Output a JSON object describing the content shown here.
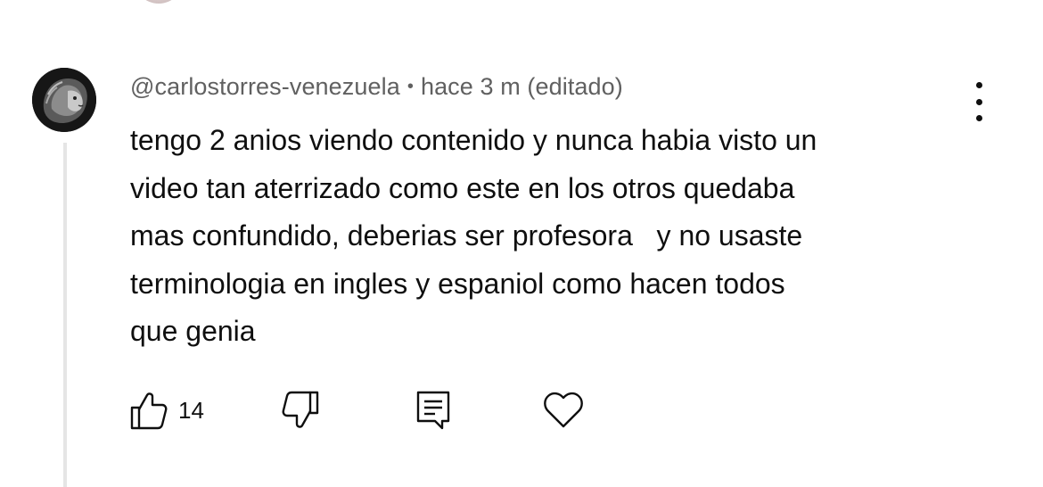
{
  "comment": {
    "author": "@carlostorres-venezuela",
    "separator": "•",
    "time": "hace 3 m (editado)",
    "text": "tengo 2 anios viendo contenido y nunca habia visto un\nvideo tan aterrizado como este en los otros quedaba\nmas confundido, deberias ser profesora   y no usaste\nterminologia en ingles y espaniol como hacen todos\nque genia",
    "like_count": "14"
  },
  "icons": {
    "like": "thumbs-up-icon",
    "dislike": "thumbs-down-icon",
    "reply": "comment-reply-icon",
    "heart": "heart-icon",
    "more": "more-vertical-icon"
  },
  "colors": {
    "text": "#0f0f0f",
    "meta": "#606060",
    "thread_line": "#e5e5e5"
  }
}
